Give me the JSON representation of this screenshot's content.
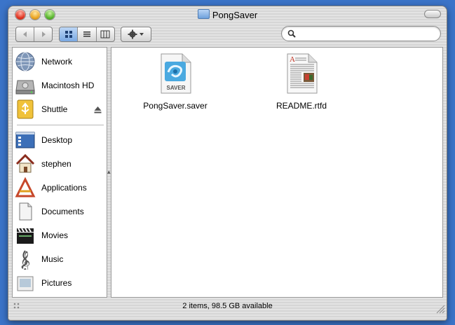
{
  "window": {
    "title": "PongSaver"
  },
  "toolbar": {
    "back_icon": "back-arrow-icon",
    "forward_icon": "forward-arrow-icon",
    "view_modes": [
      "icon-view",
      "list-view",
      "column-view"
    ],
    "active_view": "icon-view",
    "action_icon": "gear-icon",
    "search_placeholder": ""
  },
  "sidebar": {
    "devices": [
      {
        "label": "Network",
        "icon": "network-globe-icon"
      },
      {
        "label": "Macintosh HD",
        "icon": "hard-drive-icon"
      },
      {
        "label": "Shuttle",
        "icon": "usb-drive-icon",
        "ejectable": true
      }
    ],
    "places": [
      {
        "label": "Desktop",
        "icon": "desktop-icon"
      },
      {
        "label": "stephen",
        "icon": "home-icon"
      },
      {
        "label": "Applications",
        "icon": "applications-icon"
      },
      {
        "label": "Documents",
        "icon": "documents-icon"
      },
      {
        "label": "Movies",
        "icon": "movies-clapper-icon"
      },
      {
        "label": "Music",
        "icon": "music-clef-icon"
      },
      {
        "label": "Pictures",
        "icon": "pictures-icon"
      }
    ]
  },
  "files": [
    {
      "name": "PongSaver.saver",
      "icon": "screensaver-file-icon",
      "badge": "SAVER"
    },
    {
      "name": "README.rtfd",
      "icon": "rtfd-document-icon"
    }
  ],
  "status": {
    "text": "2 items, 98.5 GB available"
  },
  "colors": {
    "desktop": "#3b74c9",
    "selection_accent": "#7aa9e3"
  }
}
